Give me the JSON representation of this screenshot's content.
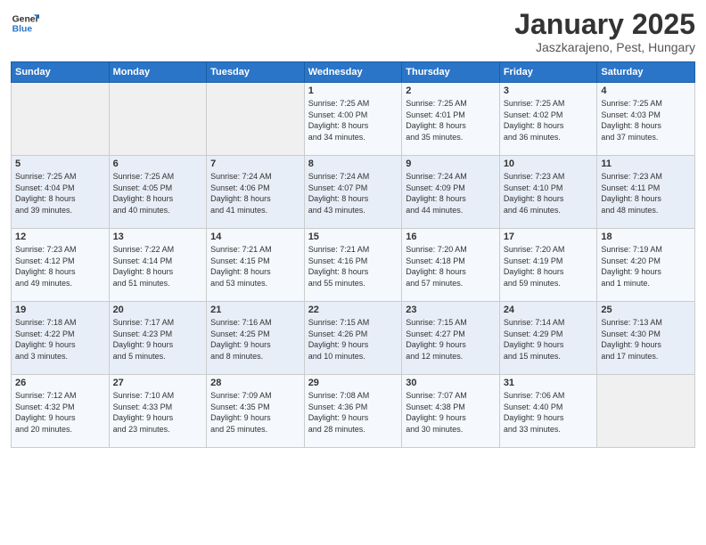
{
  "header": {
    "logo_line1": "General",
    "logo_line2": "Blue",
    "title": "January 2025",
    "subtitle": "Jaszkarajeno, Pest, Hungary"
  },
  "weekdays": [
    "Sunday",
    "Monday",
    "Tuesday",
    "Wednesday",
    "Thursday",
    "Friday",
    "Saturday"
  ],
  "weeks": [
    [
      {
        "num": "",
        "info": ""
      },
      {
        "num": "",
        "info": ""
      },
      {
        "num": "",
        "info": ""
      },
      {
        "num": "1",
        "info": "Sunrise: 7:25 AM\nSunset: 4:00 PM\nDaylight: 8 hours\nand 34 minutes."
      },
      {
        "num": "2",
        "info": "Sunrise: 7:25 AM\nSunset: 4:01 PM\nDaylight: 8 hours\nand 35 minutes."
      },
      {
        "num": "3",
        "info": "Sunrise: 7:25 AM\nSunset: 4:02 PM\nDaylight: 8 hours\nand 36 minutes."
      },
      {
        "num": "4",
        "info": "Sunrise: 7:25 AM\nSunset: 4:03 PM\nDaylight: 8 hours\nand 37 minutes."
      }
    ],
    [
      {
        "num": "5",
        "info": "Sunrise: 7:25 AM\nSunset: 4:04 PM\nDaylight: 8 hours\nand 39 minutes."
      },
      {
        "num": "6",
        "info": "Sunrise: 7:25 AM\nSunset: 4:05 PM\nDaylight: 8 hours\nand 40 minutes."
      },
      {
        "num": "7",
        "info": "Sunrise: 7:24 AM\nSunset: 4:06 PM\nDaylight: 8 hours\nand 41 minutes."
      },
      {
        "num": "8",
        "info": "Sunrise: 7:24 AM\nSunset: 4:07 PM\nDaylight: 8 hours\nand 43 minutes."
      },
      {
        "num": "9",
        "info": "Sunrise: 7:24 AM\nSunset: 4:09 PM\nDaylight: 8 hours\nand 44 minutes."
      },
      {
        "num": "10",
        "info": "Sunrise: 7:23 AM\nSunset: 4:10 PM\nDaylight: 8 hours\nand 46 minutes."
      },
      {
        "num": "11",
        "info": "Sunrise: 7:23 AM\nSunset: 4:11 PM\nDaylight: 8 hours\nand 48 minutes."
      }
    ],
    [
      {
        "num": "12",
        "info": "Sunrise: 7:23 AM\nSunset: 4:12 PM\nDaylight: 8 hours\nand 49 minutes."
      },
      {
        "num": "13",
        "info": "Sunrise: 7:22 AM\nSunset: 4:14 PM\nDaylight: 8 hours\nand 51 minutes."
      },
      {
        "num": "14",
        "info": "Sunrise: 7:21 AM\nSunset: 4:15 PM\nDaylight: 8 hours\nand 53 minutes."
      },
      {
        "num": "15",
        "info": "Sunrise: 7:21 AM\nSunset: 4:16 PM\nDaylight: 8 hours\nand 55 minutes."
      },
      {
        "num": "16",
        "info": "Sunrise: 7:20 AM\nSunset: 4:18 PM\nDaylight: 8 hours\nand 57 minutes."
      },
      {
        "num": "17",
        "info": "Sunrise: 7:20 AM\nSunset: 4:19 PM\nDaylight: 8 hours\nand 59 minutes."
      },
      {
        "num": "18",
        "info": "Sunrise: 7:19 AM\nSunset: 4:20 PM\nDaylight: 9 hours\nand 1 minute."
      }
    ],
    [
      {
        "num": "19",
        "info": "Sunrise: 7:18 AM\nSunset: 4:22 PM\nDaylight: 9 hours\nand 3 minutes."
      },
      {
        "num": "20",
        "info": "Sunrise: 7:17 AM\nSunset: 4:23 PM\nDaylight: 9 hours\nand 5 minutes."
      },
      {
        "num": "21",
        "info": "Sunrise: 7:16 AM\nSunset: 4:25 PM\nDaylight: 9 hours\nand 8 minutes."
      },
      {
        "num": "22",
        "info": "Sunrise: 7:15 AM\nSunset: 4:26 PM\nDaylight: 9 hours\nand 10 minutes."
      },
      {
        "num": "23",
        "info": "Sunrise: 7:15 AM\nSunset: 4:27 PM\nDaylight: 9 hours\nand 12 minutes."
      },
      {
        "num": "24",
        "info": "Sunrise: 7:14 AM\nSunset: 4:29 PM\nDaylight: 9 hours\nand 15 minutes."
      },
      {
        "num": "25",
        "info": "Sunrise: 7:13 AM\nSunset: 4:30 PM\nDaylight: 9 hours\nand 17 minutes."
      }
    ],
    [
      {
        "num": "26",
        "info": "Sunrise: 7:12 AM\nSunset: 4:32 PM\nDaylight: 9 hours\nand 20 minutes."
      },
      {
        "num": "27",
        "info": "Sunrise: 7:10 AM\nSunset: 4:33 PM\nDaylight: 9 hours\nand 23 minutes."
      },
      {
        "num": "28",
        "info": "Sunrise: 7:09 AM\nSunset: 4:35 PM\nDaylight: 9 hours\nand 25 minutes."
      },
      {
        "num": "29",
        "info": "Sunrise: 7:08 AM\nSunset: 4:36 PM\nDaylight: 9 hours\nand 28 minutes."
      },
      {
        "num": "30",
        "info": "Sunrise: 7:07 AM\nSunset: 4:38 PM\nDaylight: 9 hours\nand 30 minutes."
      },
      {
        "num": "31",
        "info": "Sunrise: 7:06 AM\nSunset: 4:40 PM\nDaylight: 9 hours\nand 33 minutes."
      },
      {
        "num": "",
        "info": ""
      }
    ]
  ]
}
